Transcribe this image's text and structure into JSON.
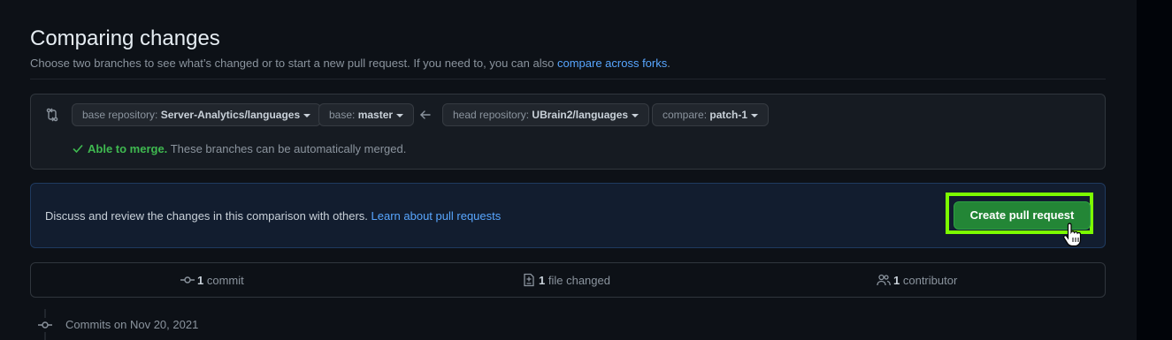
{
  "page": {
    "title": "Comparing changes",
    "subtitle_text": "Choose two branches to see what’s changed or to start a new pull request. If you need to, you can also",
    "subtitle_link": "compare across forks",
    "subtitle_end": "."
  },
  "compare": {
    "base_repo_label": "base repository:",
    "base_repo_value": "Server-Analytics/languages",
    "base_label": "base:",
    "base_value": "master",
    "head_repo_label": "head repository:",
    "head_repo_value": "UBrain2/languages",
    "compare_label": "compare:",
    "compare_value": "patch-1",
    "merge_ok": "Able to merge.",
    "merge_text": "These branches can be automatically merged."
  },
  "info": {
    "text": "Discuss and review the changes in this comparison with others.",
    "link": "Learn about pull requests",
    "button": "Create pull request"
  },
  "stats": {
    "commits_count": "1",
    "commits_label": "commit",
    "files_count": "1",
    "files_label": "file changed",
    "contributors_count": "1",
    "contributors_label": "contributor"
  },
  "timeline": {
    "heading": "Commits on Nov 20, 2021"
  },
  "colors": {
    "background": "#0d1117",
    "accent_link": "#58a6ff",
    "success": "#3fb950",
    "button_green": "#238636",
    "highlight": "#7cfc00"
  }
}
